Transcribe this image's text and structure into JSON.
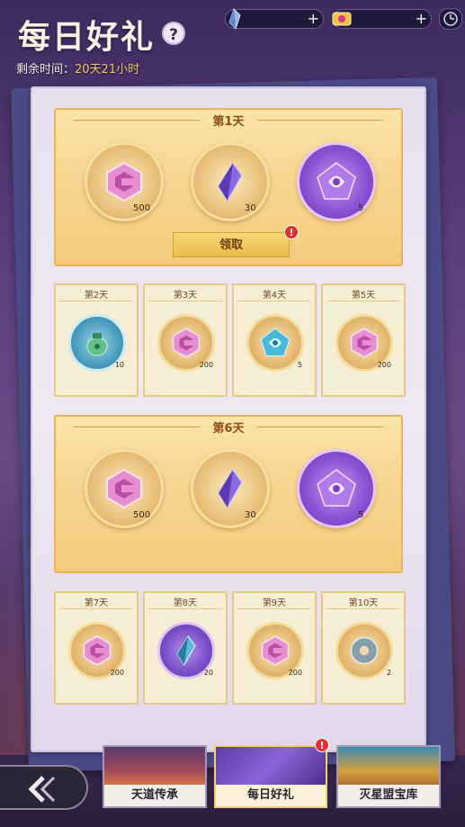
{
  "header": {
    "title": "每日好礼",
    "help_label": "?",
    "remaining_label": "剩余时间：",
    "remaining_value": "20天21小时"
  },
  "currencies": [
    {
      "icon": "crystal-icon",
      "value": "",
      "plus": "+"
    },
    {
      "icon": "ticket-icon",
      "value": "",
      "plus": "+"
    }
  ],
  "days_big": [
    {
      "label": "第1天",
      "items": [
        {
          "icon": "pink-rune-icon",
          "qty": "500"
        },
        {
          "icon": "purple-crystal-icon",
          "qty": "30"
        },
        {
          "icon": "violet-sigil-icon",
          "qty": "5"
        }
      ],
      "claim_label": "领取",
      "badge": "!"
    },
    {
      "label": "第6天",
      "items": [
        {
          "icon": "pink-rune-icon",
          "qty": "500"
        },
        {
          "icon": "purple-crystal-icon",
          "qty": "30"
        },
        {
          "icon": "violet-sigil-icon",
          "qty": "5"
        }
      ]
    }
  ],
  "days_small": [
    {
      "label": "第2天",
      "icon": "green-pouch-icon",
      "qty": "10"
    },
    {
      "label": "第3天",
      "icon": "pink-rune-icon",
      "qty": "200"
    },
    {
      "label": "第4天",
      "icon": "blue-sigil-icon",
      "qty": "5"
    },
    {
      "label": "第5天",
      "icon": "pink-rune-icon",
      "qty": "200"
    },
    {
      "label": "第7天",
      "icon": "pink-rune-icon",
      "qty": "200"
    },
    {
      "label": "第8天",
      "icon": "blue-crystal-icon",
      "qty": "20"
    },
    {
      "label": "第9天",
      "icon": "pink-rune-icon",
      "qty": "200"
    },
    {
      "label": "第10天",
      "icon": "jade-disc-icon",
      "qty": "2"
    }
  ],
  "bottom_nav": {
    "tabs": [
      {
        "label": "天道传承"
      },
      {
        "label": "每日好礼",
        "badge": "!"
      },
      {
        "label": "灭星盟宝库"
      }
    ]
  },
  "colors": {
    "gold": "#f1c560",
    "panel": "#f7d58f",
    "purple_bg": "#5a3f7e"
  }
}
